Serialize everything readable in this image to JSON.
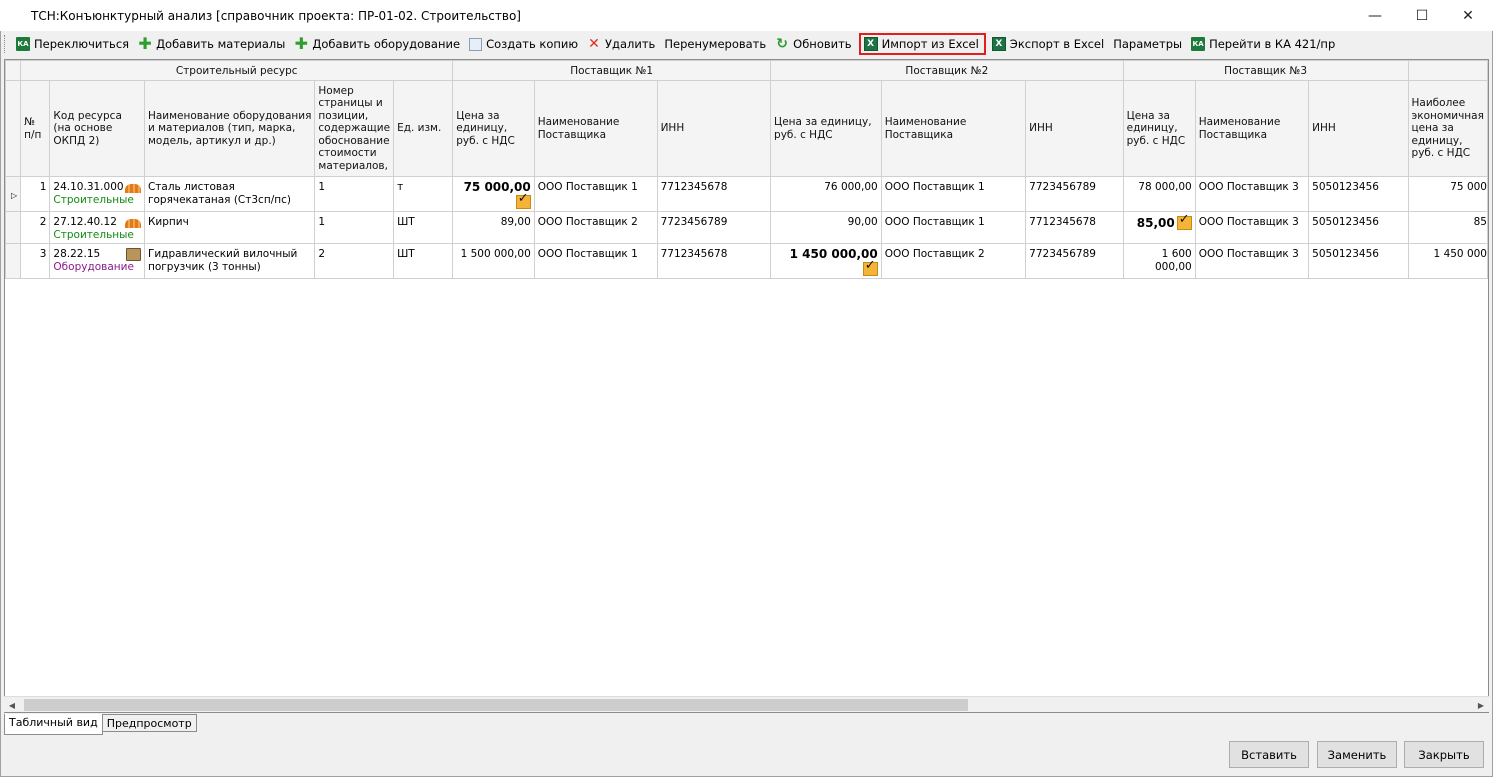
{
  "window": {
    "title": "ТСН:Конъюнктурный анализ [справочник проекта: ПР-01-02. Строительство]",
    "minimize": "—",
    "maximize": "☐",
    "close": "✕"
  },
  "toolbar": {
    "switch": "Переключиться",
    "add_materials": "Добавить материалы",
    "add_equipment": "Добавить оборудование",
    "create_copy": "Создать копию",
    "delete": "Удалить",
    "renumber": "Перенумеровать",
    "refresh": "Обновить",
    "import_excel": "Импорт из Excel",
    "export_excel": "Экспорт в Excel",
    "params": "Параметры",
    "goto_ka": "Перейти в КА 421/пр",
    "icons": {
      "switch": "ka-icon",
      "add_materials": "plus-icon",
      "add_equipment": "plus-icon",
      "create_copy": "copy-icon",
      "delete": "delete-icon",
      "refresh": "refresh-icon",
      "import_excel": "excel-icon",
      "export_excel": "excel-icon",
      "goto_ka": "ka-icon"
    }
  },
  "grid": {
    "groups": {
      "resource": "Строительный ресурс",
      "supplier1": "Поставщик №1",
      "supplier2": "Поставщик №2",
      "supplier3": "Поставщик №3"
    },
    "columns": {
      "num": "№ п/п",
      "code": "Код ресурса (на основе ОКПД 2)",
      "name": "Наименование оборудования и материалов (тип, марка, модель, артикул и др.)",
      "page": "Номер страницы и позиции, содержащие обоснование стоимости материалов,",
      "unit": "Ед. изм.",
      "s1_price": "Цена за единицу, руб. с НДС",
      "s1_name": "Наименование Поставщика",
      "s1_inn": "ИНН",
      "s2_price": "Цена за единицу, руб. с НДС",
      "s2_name": "Наименование Поставщика",
      "s2_inn": "ИНН",
      "s3_price": "Цена за единицу, руб. с НДС",
      "s3_name": "Наименование Поставщика",
      "s3_inn": "ИНН",
      "best": "Наиболее экономичная цена за единицу, руб. с НДС"
    },
    "rows": [
      {
        "num": "1",
        "code": "24.10.31.000",
        "category": "Строительные",
        "name": "Сталь листовая горячекатаная (Ст3сп/пс)",
        "page": "1",
        "unit": "т",
        "s1_price": "75 000,00",
        "s1_name": "ООО Поставщик 1",
        "s1_inn": "7712345678",
        "s2_price": "76 000,00",
        "s2_name": "ООО Поставщик 1",
        "s2_inn": "7723456789",
        "s3_price": "78 000,00",
        "s3_name": "ООО Поставщик 3",
        "s3_inn": "5050123456",
        "best": "75 000"
      },
      {
        "num": "2",
        "code": "27.12.40.12",
        "category": "Строительные",
        "name": "Кирпич",
        "page": "1",
        "unit": "ШТ",
        "s1_price": "89,00",
        "s1_name": "ООО Поставщик 2",
        "s1_inn": "7723456789",
        "s2_price": "90,00",
        "s2_name": "ООО Поставщик 1",
        "s2_inn": "7712345678",
        "s3_price": "85,00",
        "s3_name": "ООО Поставщик 3",
        "s3_inn": "5050123456",
        "best": "85"
      },
      {
        "num": "3",
        "code": "28.22.15",
        "category": "Оборудование",
        "name": "Гидравлический вилочный погрузчик (3 тонны)",
        "page": "2",
        "unit": "ШТ",
        "s1_price": "1 500 000,00",
        "s1_name": "ООО Поставщик 1",
        "s1_inn": "7712345678",
        "s2_price": "1 450 000,00",
        "s2_name": "ООО Поставщик 2",
        "s2_inn": "7723456789",
        "s3_price": "1 600 000,00",
        "s3_name": "ООО Поставщик 3",
        "s3_inn": "5050123456",
        "best": "1 450 000"
      }
    ]
  },
  "tabs": {
    "table_view": "Табличный вид",
    "preview": "Предпросмотр"
  },
  "buttons": {
    "insert": "Вставить",
    "replace": "Заменить",
    "close": "Закрыть"
  },
  "scroll": {
    "left": "◀",
    "right": "▶"
  },
  "colors": {
    "highlight_border": "#e02020",
    "category_materials": "#128a12",
    "category_equipment": "#8a1a8a"
  }
}
